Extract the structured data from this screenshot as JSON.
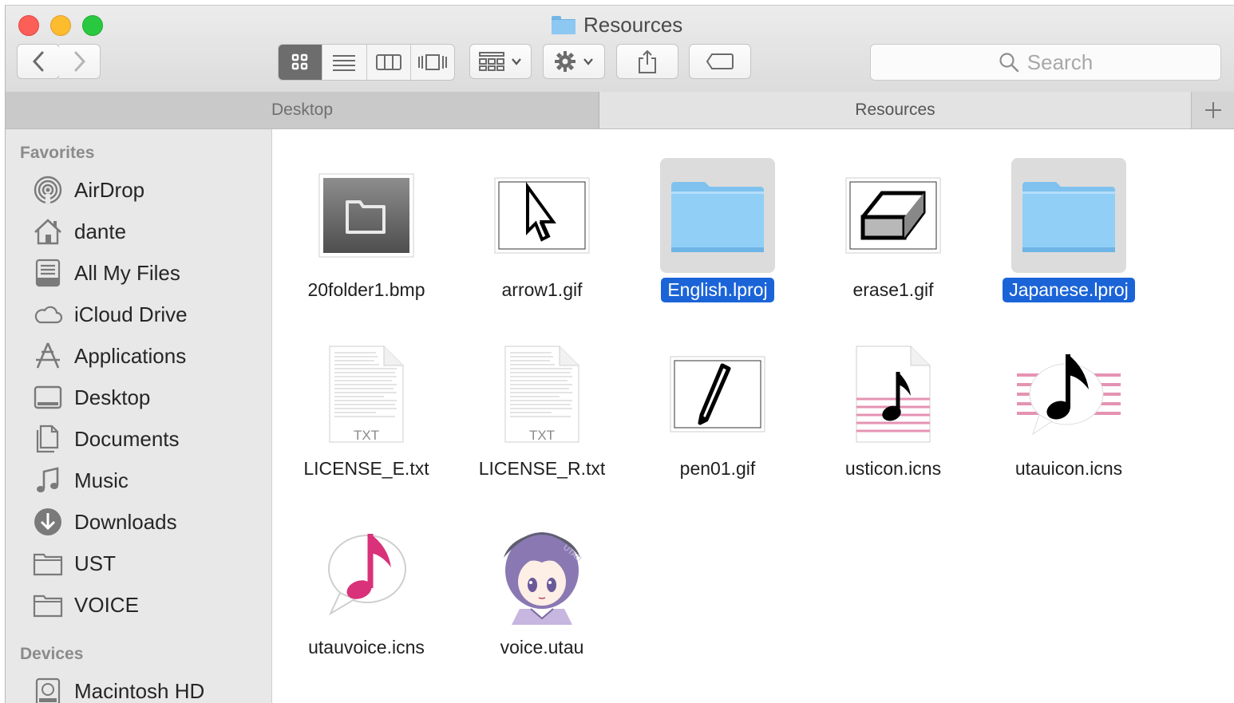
{
  "window": {
    "title": "Resources"
  },
  "toolbar": {
    "back_icon": "chevron-left-icon",
    "forward_icon": "chevron-right-icon",
    "view_modes": [
      "icon-view",
      "list-view",
      "column-view",
      "cover-flow-view"
    ],
    "active_view": "icon-view",
    "search_placeholder": "Search"
  },
  "tabs": [
    {
      "label": "Desktop",
      "active": false
    },
    {
      "label": "Resources",
      "active": true
    }
  ],
  "sidebar": {
    "favorites_header": "Favorites",
    "favorites": [
      {
        "label": "AirDrop",
        "icon": "airdrop-icon"
      },
      {
        "label": "dante",
        "icon": "home-icon"
      },
      {
        "label": "All My Files",
        "icon": "all-files-icon"
      },
      {
        "label": "iCloud Drive",
        "icon": "cloud-icon"
      },
      {
        "label": "Applications",
        "icon": "applications-icon"
      },
      {
        "label": "Desktop",
        "icon": "desktop-icon"
      },
      {
        "label": "Documents",
        "icon": "documents-icon"
      },
      {
        "label": "Music",
        "icon": "music-note-icon"
      },
      {
        "label": "Downloads",
        "icon": "downloads-icon"
      },
      {
        "label": "UST",
        "icon": "folder-icon"
      },
      {
        "label": "VOICE",
        "icon": "folder-icon"
      }
    ],
    "devices_header": "Devices",
    "devices": [
      {
        "label": "Macintosh HD",
        "icon": "hard-drive-icon"
      }
    ]
  },
  "files": [
    {
      "name": "20folder1.bmp",
      "kind": "bmp",
      "selected": false
    },
    {
      "name": "arrow1.gif",
      "kind": "gif-arrow",
      "selected": false
    },
    {
      "name": "English.lproj",
      "kind": "folder",
      "selected": true
    },
    {
      "name": "erase1.gif",
      "kind": "gif-eraser",
      "selected": false
    },
    {
      "name": "Japanese.lproj",
      "kind": "folder",
      "selected": true
    },
    {
      "name": "LICENSE_E.txt",
      "kind": "txt",
      "badge": "TXT",
      "selected": false
    },
    {
      "name": "LICENSE_R.txt",
      "kind": "txt",
      "badge": "TXT",
      "selected": false
    },
    {
      "name": "pen01.gif",
      "kind": "gif-pen",
      "selected": false
    },
    {
      "name": "usticon.icns",
      "kind": "icns-ust",
      "selected": false
    },
    {
      "name": "utauicon.icns",
      "kind": "icns-utau",
      "selected": false
    },
    {
      "name": "utauvoice.icns",
      "kind": "icns-voice",
      "selected": false
    },
    {
      "name": "voice.utau",
      "kind": "utau-avatar",
      "selected": false
    }
  ],
  "colors": {
    "selection": "#1b64d8",
    "folder": "#8cc8f2",
    "accent_pink": "#d9317a"
  }
}
